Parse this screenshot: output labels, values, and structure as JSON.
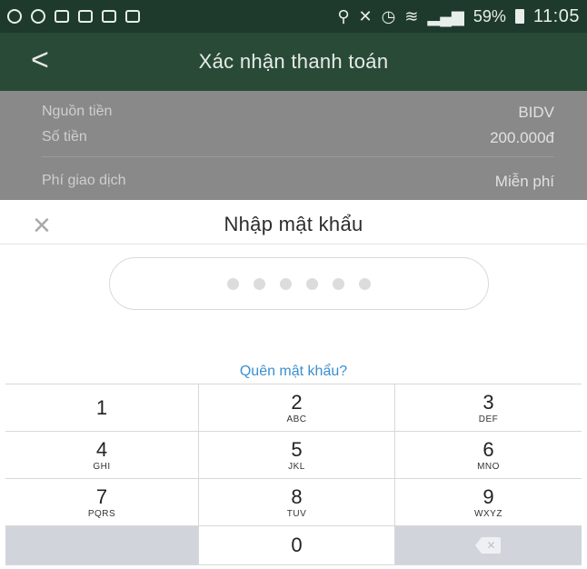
{
  "status_bar": {
    "battery": "59%",
    "time": "11:05"
  },
  "header": {
    "back_glyph": "<",
    "title": "Xác nhận thanh toán"
  },
  "summary": {
    "rows": [
      {
        "label": "Nguồn tiền",
        "value": "BIDV"
      },
      {
        "label": "Số tiền",
        "value": "200.000đ"
      },
      {
        "label": "Phí giao dịch",
        "value": "Miễn phí"
      }
    ]
  },
  "sheet": {
    "close_glyph": "×",
    "title": "Nhập mật khẩu",
    "pin_length": 6,
    "forgot_link": "Quên mật khẩu?"
  },
  "keypad": {
    "keys": [
      {
        "num": "1",
        "letters": ""
      },
      {
        "num": "2",
        "letters": "ABC"
      },
      {
        "num": "3",
        "letters": "DEF"
      },
      {
        "num": "4",
        "letters": "GHI"
      },
      {
        "num": "5",
        "letters": "JKL"
      },
      {
        "num": "6",
        "letters": "MNO"
      },
      {
        "num": "7",
        "letters": "PQRS"
      },
      {
        "num": "8",
        "letters": "TUV"
      },
      {
        "num": "9",
        "letters": "WXYZ"
      },
      {
        "num": "0",
        "letters": ""
      }
    ],
    "delete_icon": "backspace-icon"
  },
  "colors": {
    "header_bg": "#2a4a38",
    "status_bg": "#1e3a2c",
    "link": "#3a8fd0",
    "dim_overlay": "#898989"
  }
}
